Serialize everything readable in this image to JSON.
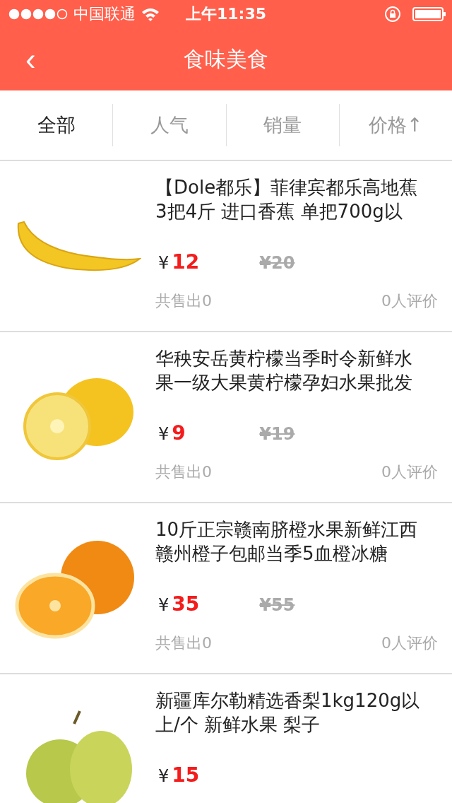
{
  "status_bar": {
    "carrier": "中国联通",
    "time": "上午11:35"
  },
  "nav": {
    "back": "‹",
    "title": "食味美食"
  },
  "tabs": [
    {
      "label": "全部",
      "selected": true
    },
    {
      "label": "人气",
      "selected": false
    },
    {
      "label": "销量",
      "selected": false
    },
    {
      "label": "价格↑",
      "selected": false
    }
  ],
  "products": [
    {
      "kind": "banana",
      "title": "【Dole都乐】菲律宾都乐高地蕉3把4斤 进口香蕉 单把700g以",
      "currency": "¥",
      "price": "12",
      "old_price": "¥20",
      "sold": "共售出0",
      "reviews": "0人评价"
    },
    {
      "kind": "lemon",
      "title": " 华秧安岳黄柠檬当季时令新鲜水果一级大果黄柠檬孕妇水果批发",
      "currency": "¥",
      "price": "9",
      "old_price": "¥19",
      "sold": "共售出0",
      "reviews": "0人评价"
    },
    {
      "kind": "orange",
      "title": " 10斤正宗赣南脐橙水果新鲜江西赣州橙子包邮当季5血橙冰糖",
      "currency": "¥",
      "price": "35",
      "old_price": "¥55",
      "sold": "共售出0",
      "reviews": "0人评价"
    },
    {
      "kind": "pear",
      "title": " 新疆库尔勒精选香梨1kg120g以上/个 新鲜水果 梨子",
      "currency": "¥",
      "price": "15"
    }
  ]
}
